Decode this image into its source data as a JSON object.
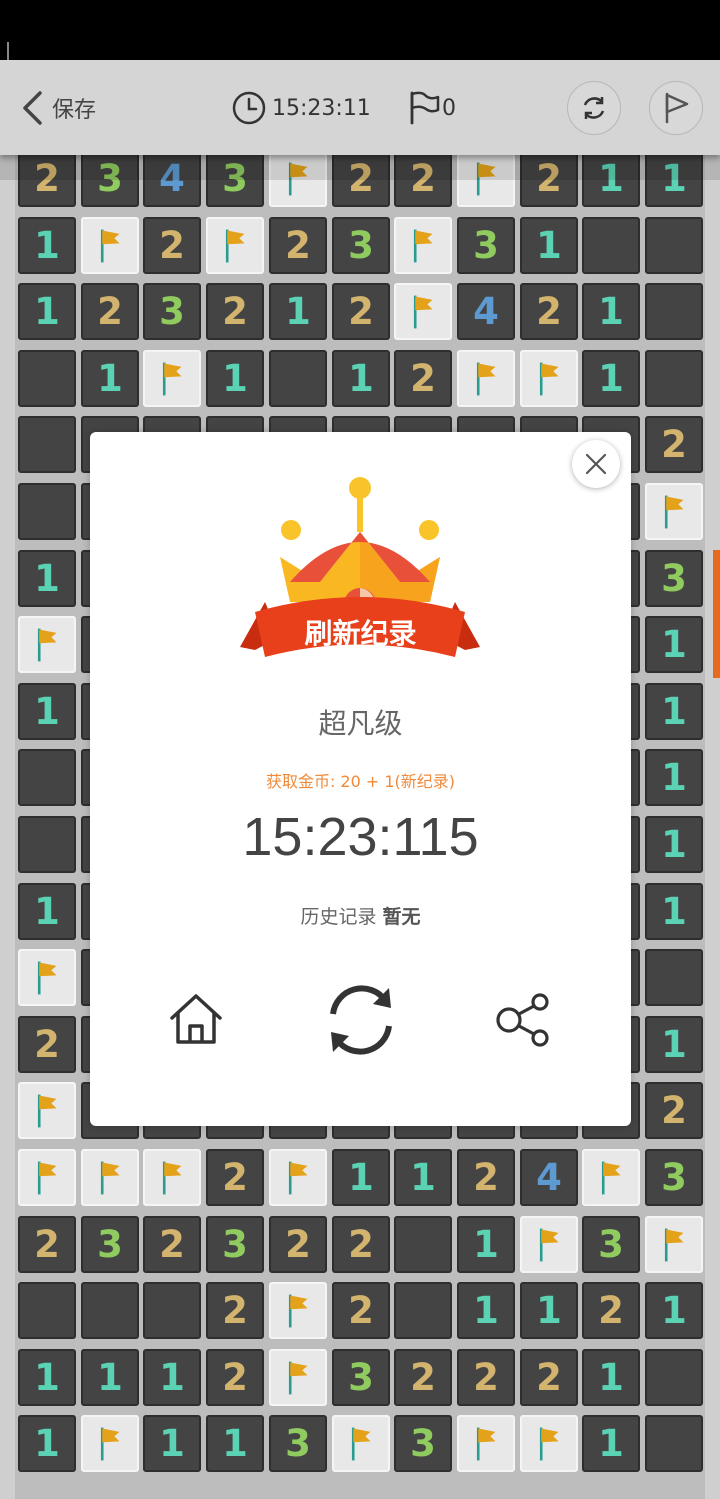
{
  "header": {
    "back_label": "保存",
    "timer": "15:23:11",
    "flag_count": "0"
  },
  "board": {
    "rows": [
      [
        "2",
        "3",
        "4",
        "3",
        "F",
        "2",
        "2",
        "F",
        "2",
        "1",
        "1"
      ],
      [
        "1",
        "F",
        "2",
        "F",
        "2",
        "3",
        "F",
        "3",
        "1",
        "",
        ""
      ],
      [
        "1",
        "2",
        "3",
        "2",
        "1",
        "2",
        "F",
        "4",
        "2",
        "1",
        ""
      ],
      [
        "",
        "1",
        "F",
        "1",
        "",
        "1",
        "2",
        "F",
        "F",
        "1",
        ""
      ],
      [
        "",
        "",
        "",
        "",
        "",
        "",
        "",
        "",
        "",
        "",
        "2"
      ],
      [
        "",
        "",
        "",
        "",
        "",
        "",
        "",
        "",
        "",
        "",
        "F"
      ],
      [
        "1",
        "",
        "",
        "",
        "",
        "",
        "",
        "",
        "",
        "",
        "3"
      ],
      [
        "F",
        "",
        "",
        "",
        "",
        "",
        "",
        "",
        "",
        "",
        "1"
      ],
      [
        "1",
        "",
        "",
        "",
        "",
        "",
        "",
        "",
        "",
        "",
        "1"
      ],
      [
        "",
        "",
        "",
        "",
        "",
        "",
        "",
        "",
        "",
        "",
        "1"
      ],
      [
        "",
        "",
        "",
        "",
        "",
        "",
        "",
        "",
        "",
        "",
        "1"
      ],
      [
        "1",
        "",
        "",
        "",
        "",
        "",
        "",
        "",
        "",
        "",
        "1"
      ],
      [
        "F",
        "",
        "",
        "",
        "",
        "",
        "",
        "",
        "",
        "",
        ""
      ],
      [
        "2",
        "",
        "",
        "",
        "",
        "",
        "",
        "",
        "",
        "",
        "1"
      ],
      [
        "F",
        "",
        "",
        "",
        "",
        "",
        "",
        "",
        "",
        "",
        "2"
      ],
      [
        "F",
        "F",
        "F",
        "2",
        "F",
        "1",
        "1",
        "2",
        "4",
        "F",
        "3"
      ],
      [
        "2",
        "3",
        "2",
        "3",
        "2",
        "2",
        "",
        "1",
        "F",
        "3",
        "F"
      ],
      [
        "",
        "",
        "",
        "2",
        "F",
        "2",
        "",
        "1",
        "1",
        "2",
        "1"
      ],
      [
        "1",
        "1",
        "1",
        "2",
        "F",
        "3",
        "2",
        "2",
        "2",
        "1",
        ""
      ],
      [
        "1",
        "F",
        "1",
        "1",
        "3",
        "F",
        "3",
        "F",
        "F",
        "1",
        ""
      ]
    ]
  },
  "dialog": {
    "banner": "刷新纪录",
    "difficulty": "超凡级",
    "reward": "获取金币: 20 + 1(新纪录)",
    "record_time": "15:23:115",
    "history_label": "历史记录",
    "history_value": "暂无"
  },
  "icons": {
    "back": "chevron-left-icon",
    "timer": "clock-icon",
    "flag": "flag-icon",
    "restart": "refresh-icon",
    "mark": "flag-icon",
    "close": "close-icon",
    "home": "home-icon",
    "replay": "refresh-icon",
    "share": "share-icon"
  },
  "colors": {
    "accent": "#e86a1d",
    "ribbon": "#e8401a",
    "crown_yellow": "#f9c42a",
    "number_1": "#5ad2b3",
    "number_2": "#d3b46e",
    "number_3": "#8fcb5e",
    "number_4": "#5c9ad1"
  }
}
